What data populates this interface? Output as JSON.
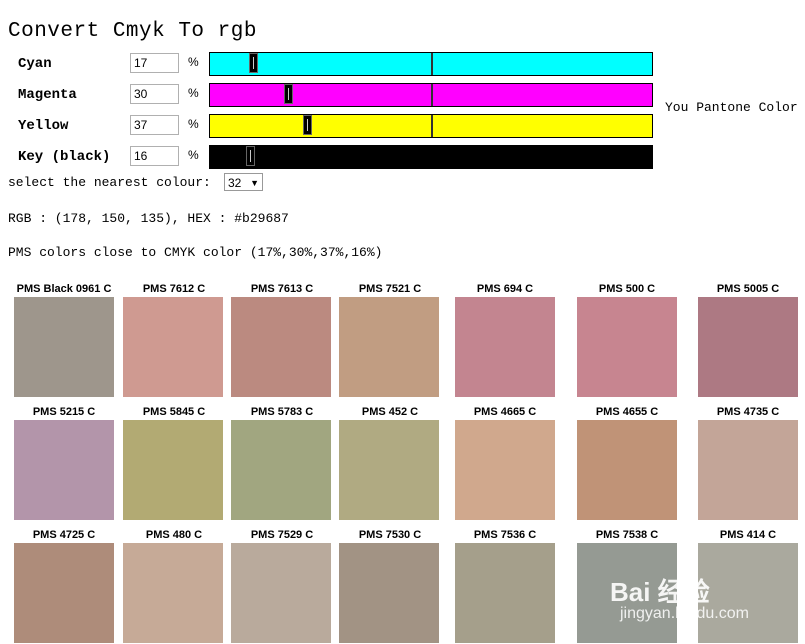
{
  "title": "Convert Cmyk To rgb",
  "sliders": [
    {
      "label": "Cyan",
      "value": "17",
      "pct": "%",
      "color": "#00ffff",
      "level": 17
    },
    {
      "label": "Magenta",
      "value": "30",
      "pct": "%",
      "color": "#ff00ff",
      "level": 30
    },
    {
      "label": "Yellow",
      "value": "37",
      "pct": "%",
      "color": "#ffff00",
      "level": 37
    },
    {
      "label": "Key (black)",
      "value": "16",
      "pct": "%",
      "color": "#000000",
      "level": 16
    }
  ],
  "side_label": "You Pantone Color",
  "select": {
    "label": "select the nearest colour:",
    "value": "32"
  },
  "rgb_line": "RGB : (178, 150, 135), HEX : #b29687",
  "pms_line": "PMS colors close to CMYK color (17%,30%,37%,16%)",
  "swatches": [
    {
      "name": "PMS Black 0961 C",
      "color": "#9e968c"
    },
    {
      "name": "PMS 7612 C",
      "color": "#cf9a91"
    },
    {
      "name": "PMS 7613 C",
      "color": "#bb8a80"
    },
    {
      "name": "PMS 7521 C",
      "color": "#c19d82"
    },
    {
      "name": "PMS 694 C",
      "color": "#c38590"
    },
    {
      "name": "PMS 500 C",
      "color": "#c78590"
    },
    {
      "name": "PMS 5005 C",
      "color": "#ad7983"
    },
    {
      "name": "PMS 5215 C",
      "color": "#b395aa"
    },
    {
      "name": "PMS 5845 C",
      "color": "#b2aa73"
    },
    {
      "name": "PMS 5783 C",
      "color": "#a1a680"
    },
    {
      "name": "PMS 452 C",
      "color": "#b0aa82"
    },
    {
      "name": "PMS 4665 C",
      "color": "#d0a88d"
    },
    {
      "name": "PMS 4655 C",
      "color": "#c09377"
    },
    {
      "name": "PMS 4735 C",
      "color": "#c3a598"
    },
    {
      "name": "PMS 4725 C",
      "color": "#ae8c7a"
    },
    {
      "name": "PMS 480 C",
      "color": "#c6aa97"
    },
    {
      "name": "PMS 7529 C",
      "color": "#b9aa9c"
    },
    {
      "name": "PMS 7530 C",
      "color": "#a29384"
    },
    {
      "name": "PMS 7536 C",
      "color": "#a59f8b"
    },
    {
      "name": "PMS 7538 C",
      "color": "#959a93"
    },
    {
      "name": "PMS 414 C",
      "color": "#aaa99e"
    }
  ],
  "watermark": {
    "brand": "Bai 经验",
    "url": "jingyan.baidu.com"
  }
}
